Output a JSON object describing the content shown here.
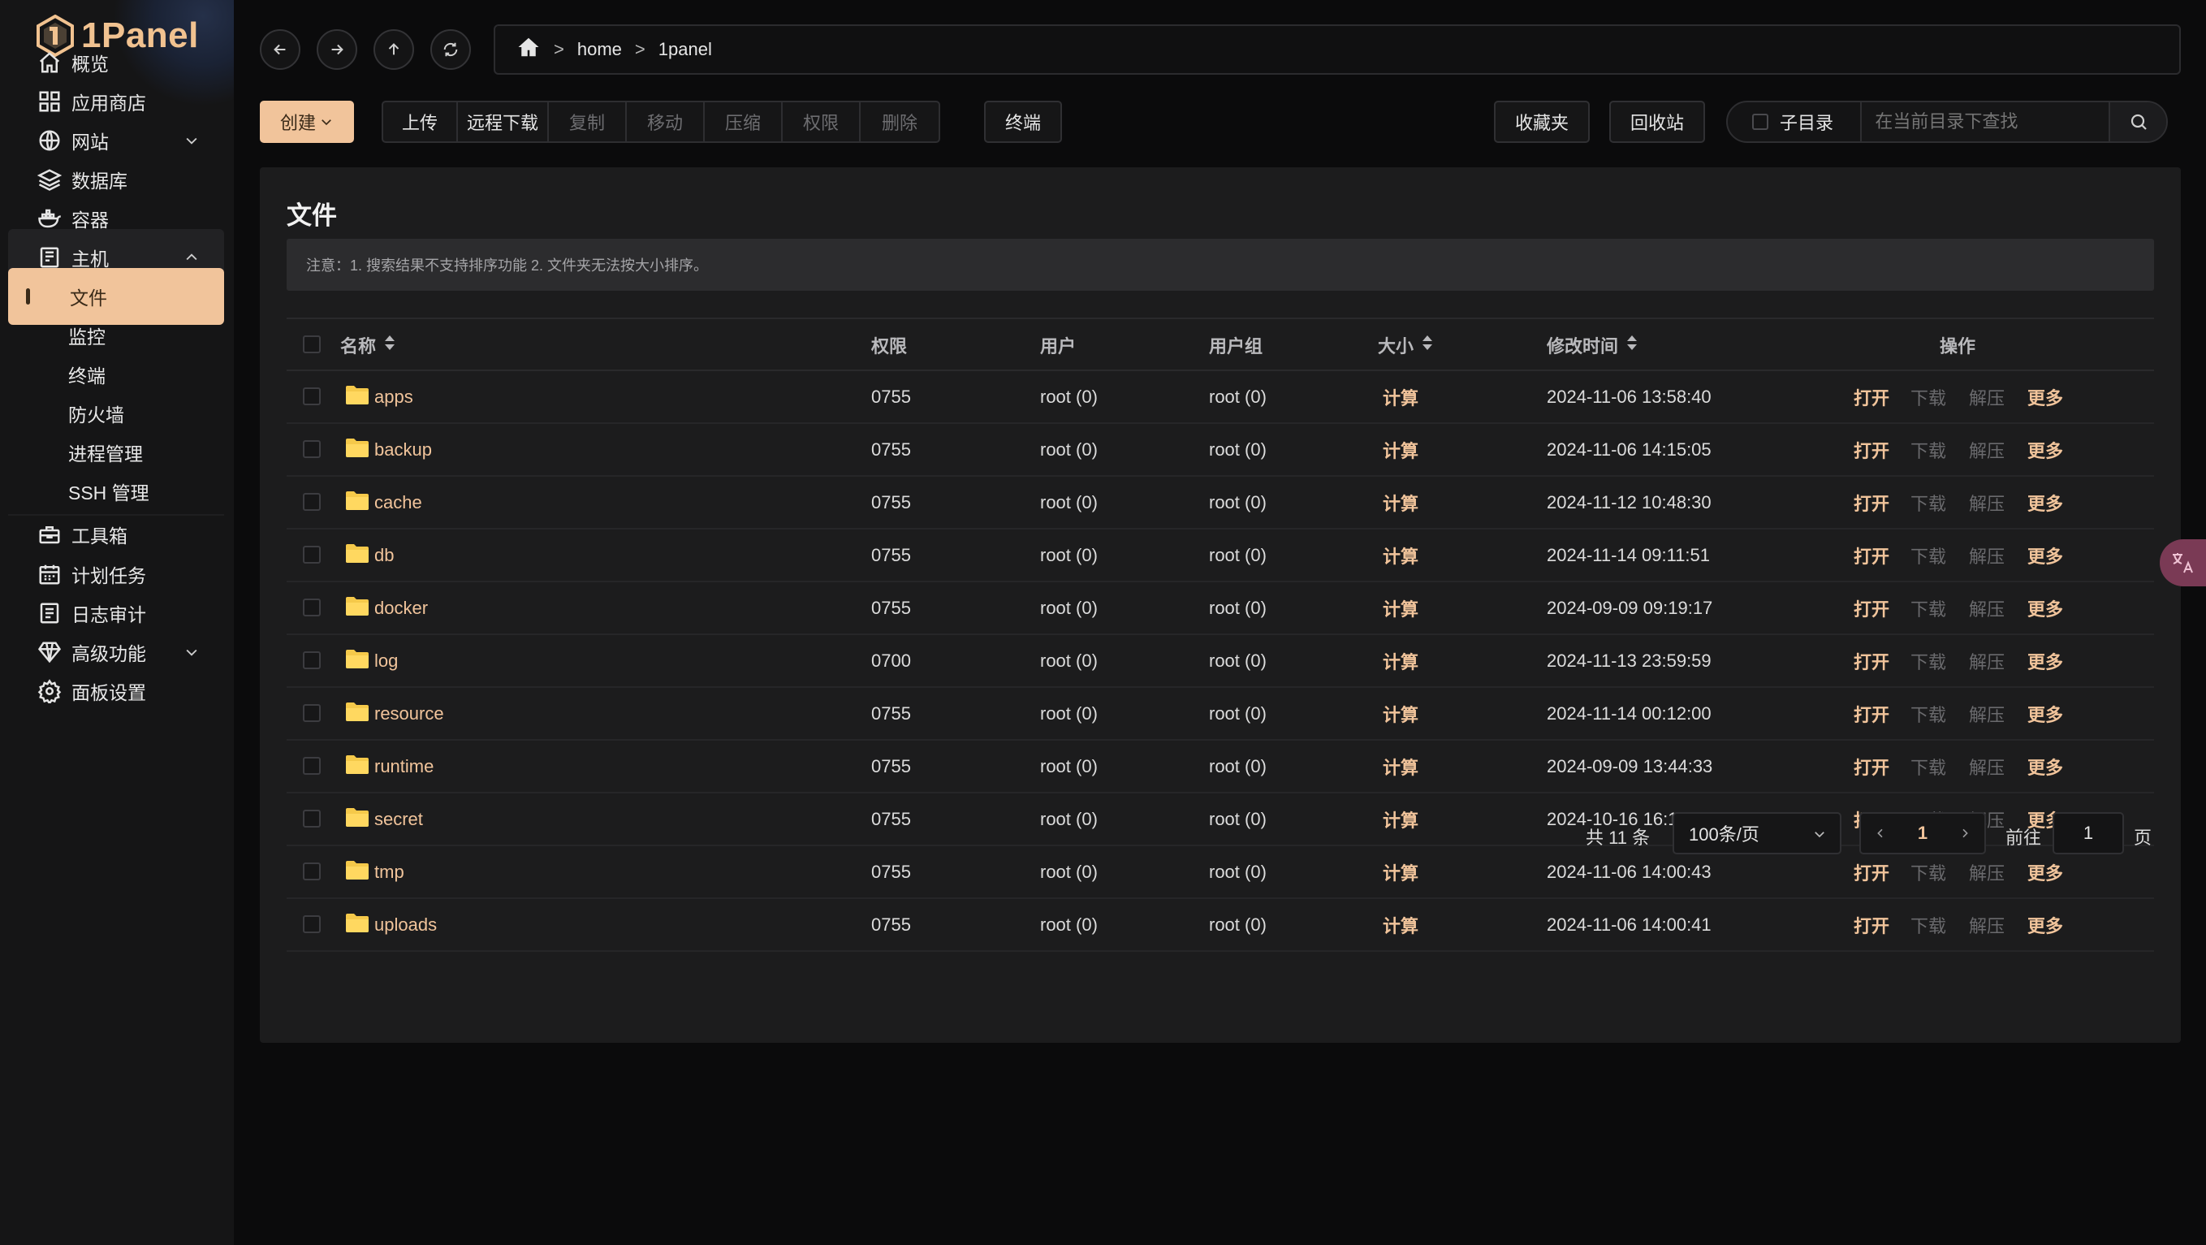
{
  "app": {
    "logo_text": "1Panel"
  },
  "sidebar": {
    "items": [
      {
        "label": "概览",
        "icon": "home-icon"
      },
      {
        "label": "应用商店",
        "icon": "grid-icon"
      },
      {
        "label": "网站",
        "icon": "globe-icon",
        "has_children": true
      },
      {
        "label": "数据库",
        "icon": "layers-icon"
      },
      {
        "label": "容器",
        "icon": "docker-icon"
      },
      {
        "label": "主机",
        "icon": "server-icon",
        "expanded": true
      },
      {
        "label": "工具箱",
        "icon": "toolbox-icon"
      },
      {
        "label": "计划任务",
        "icon": "calendar-icon"
      },
      {
        "label": "日志审计",
        "icon": "log-icon"
      },
      {
        "label": "高级功能",
        "icon": "diamond-icon",
        "has_children": true
      },
      {
        "label": "面板设置",
        "icon": "gear-icon"
      }
    ],
    "host_children": [
      "文件",
      "监控",
      "终端",
      "防火墙",
      "进程管理",
      "SSH 管理"
    ],
    "active_child": "文件"
  },
  "breadcrumb": {
    "items": [
      "home",
      "1panel"
    ]
  },
  "toolbar": {
    "create": "创建",
    "group": [
      {
        "label": "上传",
        "enabled": true
      },
      {
        "label": "远程下载",
        "enabled": true
      },
      {
        "label": "复制",
        "enabled": false
      },
      {
        "label": "移动",
        "enabled": false
      },
      {
        "label": "压缩",
        "enabled": false
      },
      {
        "label": "权限",
        "enabled": false
      },
      {
        "label": "删除",
        "enabled": false
      }
    ],
    "terminal": "终端",
    "favorites": "收藏夹",
    "recycle_bin": "回收站",
    "subdir_label": "子目录",
    "search_placeholder": "在当前目录下查找"
  },
  "card": {
    "title": "文件",
    "notice": "注意：1. 搜索结果不支持排序功能 2. 文件夹无法按大小排序。"
  },
  "table": {
    "columns": {
      "name": "名称",
      "perm": "权限",
      "user": "用户",
      "group": "用户组",
      "size": "大小",
      "mtime": "修改时间",
      "ops": "操作"
    },
    "actions": {
      "open": "打开",
      "download": "下载",
      "extract": "解压",
      "more": "更多",
      "calc": "计算"
    },
    "rows": [
      {
        "name": "apps",
        "perm": "0755",
        "user": "root (0)",
        "group": "root (0)",
        "mtime": "2024-11-06 13:58:40"
      },
      {
        "name": "backup",
        "perm": "0755",
        "user": "root (0)",
        "group": "root (0)",
        "mtime": "2024-11-06 14:15:05"
      },
      {
        "name": "cache",
        "perm": "0755",
        "user": "root (0)",
        "group": "root (0)",
        "mtime": "2024-11-12 10:48:30"
      },
      {
        "name": "db",
        "perm": "0755",
        "user": "root (0)",
        "group": "root (0)",
        "mtime": "2024-11-14 09:11:51"
      },
      {
        "name": "docker",
        "perm": "0755",
        "user": "root (0)",
        "group": "root (0)",
        "mtime": "2024-09-09 09:19:17"
      },
      {
        "name": "log",
        "perm": "0700",
        "user": "root (0)",
        "group": "root (0)",
        "mtime": "2024-11-13 23:59:59"
      },
      {
        "name": "resource",
        "perm": "0755",
        "user": "root (0)",
        "group": "root (0)",
        "mtime": "2024-11-14 00:12:00"
      },
      {
        "name": "runtime",
        "perm": "0755",
        "user": "root (0)",
        "group": "root (0)",
        "mtime": "2024-09-09 13:44:33"
      },
      {
        "name": "secret",
        "perm": "0755",
        "user": "root (0)",
        "group": "root (0)",
        "mtime": "2024-10-16 16:11:25"
      },
      {
        "name": "tmp",
        "perm": "0755",
        "user": "root (0)",
        "group": "root (0)",
        "mtime": "2024-11-06 14:00:43"
      },
      {
        "name": "uploads",
        "perm": "0755",
        "user": "root (0)",
        "group": "root (0)",
        "mtime": "2024-11-06 14:00:41"
      }
    ]
  },
  "pagination": {
    "total": "共 11 条",
    "page_size": "100条/页",
    "current_page": "1",
    "goto_label": "前往",
    "goto_value": "1",
    "page_suffix": "页"
  },
  "colors": {
    "accent": "#f1c49b",
    "background": "#0b0b0c",
    "card": "#1c1c1d",
    "folder": "#f5c94a"
  }
}
